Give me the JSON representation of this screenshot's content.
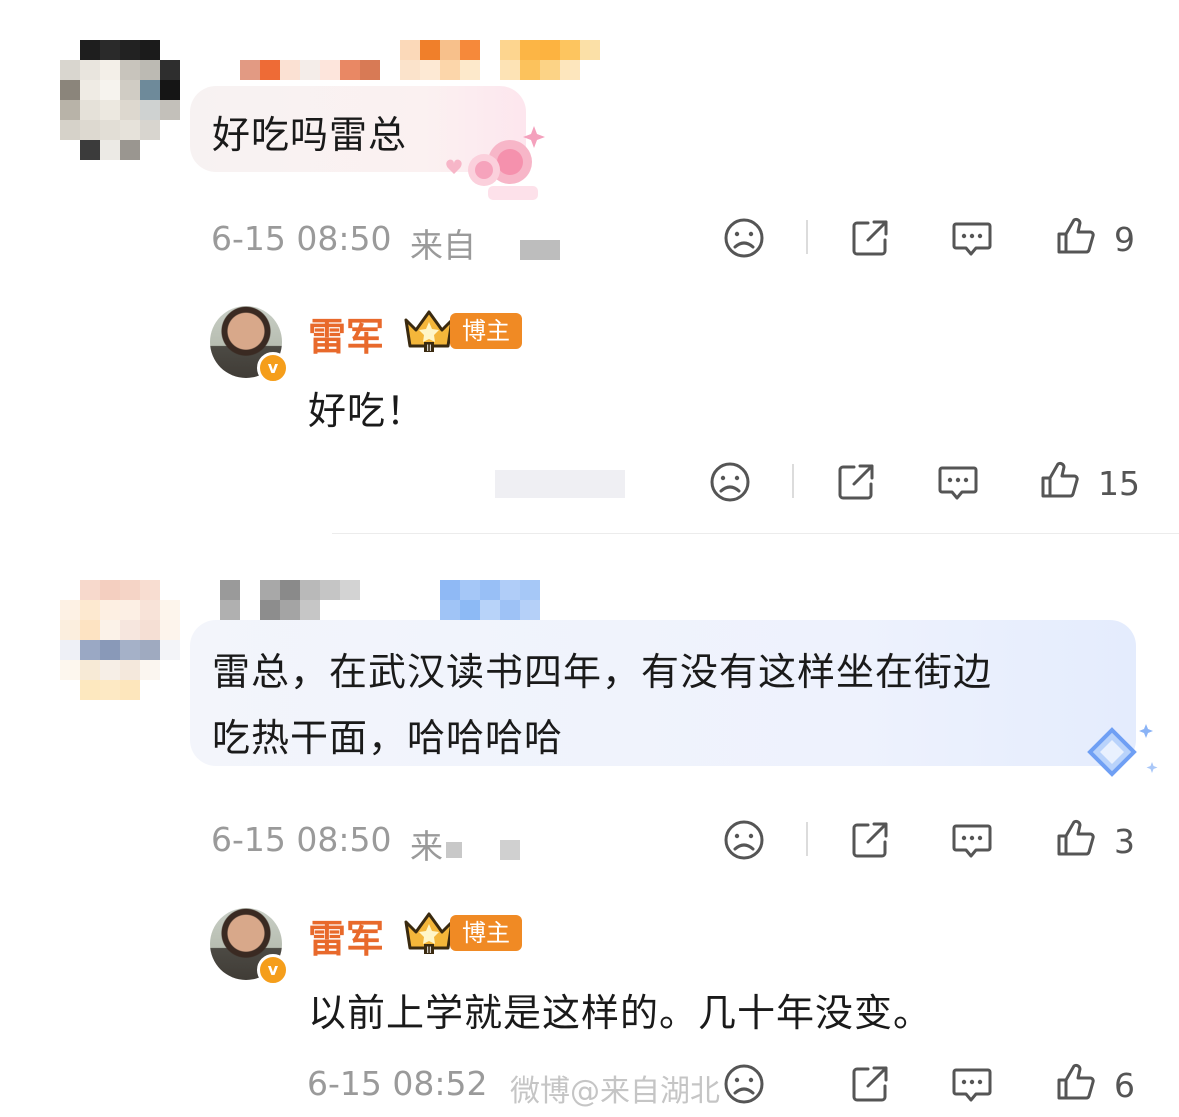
{
  "comments": [
    {
      "text": "好吃吗雷总",
      "time": "6-15 08:50",
      "source_prefix": "来自",
      "likes": "9",
      "reply": {
        "author": "雷军",
        "badge": "博主",
        "text": "好吃！",
        "likes": "15"
      }
    },
    {
      "text_line1": "雷总，在武汉读书四年，有没有这样坐在街边",
      "text_line2": "吃热干面，哈哈哈哈",
      "time": "6-15 08:50",
      "source_prefix": "来",
      "likes": "3",
      "reply": {
        "author": "雷军",
        "badge": "博主",
        "text": "以前上学就是这样的。几十年没变。",
        "time": "6-15 08:52",
        "likes": "6"
      }
    }
  ],
  "verified_mark": "v",
  "watermark": "微博@来自湖北",
  "colors": {
    "author_orange": "#e8692b",
    "badge_orange": "#f08a24",
    "meta_gray": "#9a9a9a"
  },
  "icons": [
    "dislike-icon",
    "share-icon",
    "comment-icon",
    "like-icon"
  ]
}
